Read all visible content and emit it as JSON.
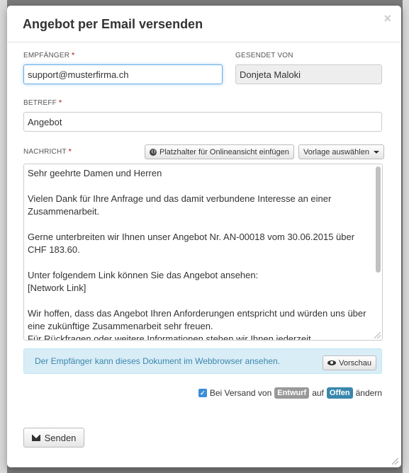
{
  "modal": {
    "title": "Angebot per Email versenden",
    "close_symbol": "×"
  },
  "recipient": {
    "label": "EMPFÄNGER",
    "required_mark": "*",
    "value": "support@musterfirma.ch"
  },
  "sender": {
    "label": "GESENDET VON",
    "value": "Donjeta Maloki"
  },
  "subject": {
    "label": "BETREFF",
    "required_mark": "*",
    "value": "Angebot"
  },
  "message": {
    "label": "NACHRICHT",
    "required_mark": "*",
    "placeholder_button": "Platzhalter für Onlineansicht einfügen",
    "template_button": "Vorlage auswählen",
    "lines": [
      "Sehr geehrte Damen und Herren",
      "",
      "Vielen Dank für Ihre Anfrage und das damit verbundene Interesse an einer Zusammenarbeit.",
      "",
      "Gerne unterbreiten wir Ihnen unser Angebot Nr. AN-00018 vom 30.06.2015 über CHF 183.60.",
      "",
      "Unter folgendem Link können Sie das Angebot ansehen:",
      "[Network Link]",
      "",
      "Wir hoffen, dass das Angebot Ihren Anforderungen entspricht und würden uns über eine zukünftige Zusammenarbeit sehr freuen.",
      "Für Rückfragen oder weitere Informationen stehen wir Ihnen jederzeit"
    ]
  },
  "info": {
    "text": "Der Empfänger kann dieses Dokument im Webbrowser ansehen.",
    "preview_button": "Vorschau"
  },
  "status_change": {
    "checked": true,
    "text_before": "Bei Versand von",
    "from_status": "Entwurf",
    "text_mid": "auf",
    "to_status": "Offen",
    "text_after": "ändern",
    "colors": {
      "from": "#999999",
      "to": "#3a87ad"
    }
  },
  "actions": {
    "send_label": "Senden"
  }
}
